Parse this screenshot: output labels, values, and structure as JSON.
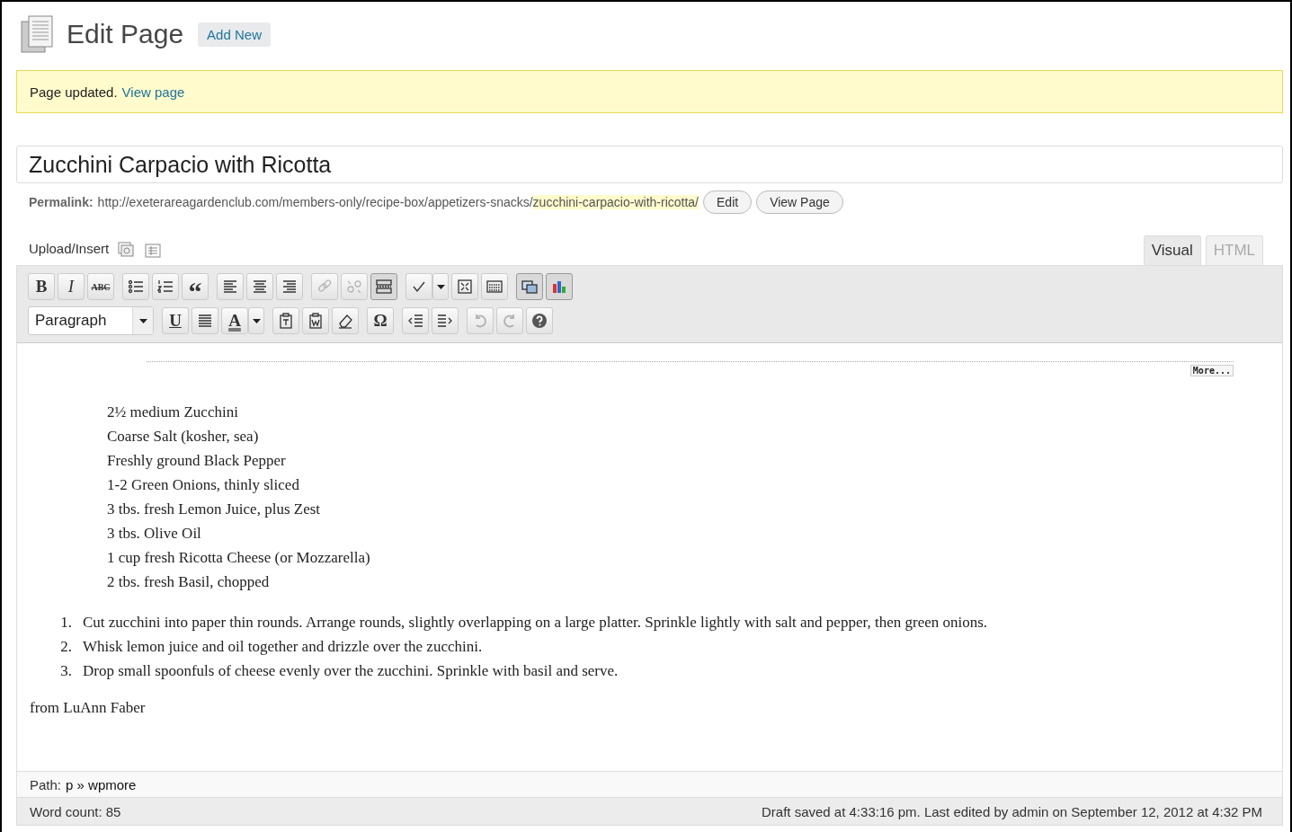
{
  "header": {
    "title": "Edit Page",
    "add_new": "Add New"
  },
  "notice": {
    "text": "Page updated.",
    "link": "View page"
  },
  "post_title": "Zucchini Carpacio with Ricotta",
  "permalink": {
    "label": "Permalink:",
    "base": "http://exeterareagardenclub.com/members-only/recipe-box/appetizers-snacks/",
    "slug": "zucchini-carpacio-with-ricotta/",
    "buttons": [
      "Edit",
      "View Page"
    ]
  },
  "upload_label": "Upload/Insert",
  "editor_tabs": [
    {
      "label": "Visual",
      "selected": true
    },
    {
      "label": "HTML",
      "selected": false
    }
  ],
  "toolbar_rows": [
    [
      [
        {
          "kind": "bold",
          "text": "B"
        },
        {
          "kind": "italic",
          "text": "I"
        },
        {
          "kind": "strike",
          "text": "ABC"
        }
      ],
      [
        {
          "kind": "bullets"
        },
        {
          "kind": "numbers"
        },
        {
          "kind": "quote",
          "text": "“"
        }
      ],
      [
        {
          "kind": "alignleft"
        },
        {
          "kind": "aligncenter"
        },
        {
          "kind": "alignright"
        }
      ],
      [
        {
          "kind": "link",
          "disabled": true
        },
        {
          "kind": "unlink",
          "disabled": true
        },
        {
          "kind": "more",
          "pressed": true
        }
      ],
      [
        {
          "kind": "spell"
        },
        {
          "kind": "dropdown"
        },
        {
          "kind": "fullscreen"
        },
        {
          "kind": "kitchen"
        }
      ],
      [
        {
          "kind": "gallery",
          "pressed": true
        },
        {
          "kind": "chart",
          "pressed": true
        }
      ]
    ],
    [
      [
        {
          "kind": "select",
          "text": "Paragraph"
        }
      ],
      [
        {
          "kind": "underline",
          "text": "U"
        },
        {
          "kind": "justify"
        },
        {
          "kind": "color",
          "text": "A"
        },
        {
          "kind": "dropdown"
        }
      ],
      [
        {
          "kind": "pastetext"
        },
        {
          "kind": "pasteword"
        },
        {
          "kind": "eraser"
        }
      ],
      [
        {
          "kind": "omega",
          "text": "Ω"
        }
      ],
      [
        {
          "kind": "outdent"
        },
        {
          "kind": "indent"
        }
      ],
      [
        {
          "kind": "undo",
          "disabled": true
        },
        {
          "kind": "redo",
          "disabled": true
        },
        {
          "kind": "help"
        }
      ]
    ]
  ],
  "more_label": "More...",
  "ingredients": [
    "2½ medium Zucchini",
    "Coarse Salt (kosher, sea)",
    "Freshly ground Black Pepper",
    "1-2 Green Onions, thinly sliced",
    "3 tbs. fresh Lemon Juice, plus Zest",
    "3 tbs. Olive Oil",
    "1 cup fresh Ricotta Cheese (or Mozzarella)",
    "2 tbs. fresh Basil, chopped"
  ],
  "steps": [
    {
      "num": "1.",
      "text": "Cut zucchini into paper thin rounds. Arrange rounds, slightly overlapping on a large platter. Sprinkle lightly with salt and pepper, then green onions."
    },
    {
      "num": "2.",
      "text": "Whisk lemon juice and oil together and drizzle over the zucchini."
    },
    {
      "num": "3.",
      "text": "Drop small spoonfuls of cheese evenly over the zucchini. Sprinkle with basil and serve."
    }
  ],
  "credit": "from LuAnn Faber",
  "path": {
    "label": "Path:",
    "value": "p » wpmore"
  },
  "word_count": "Word count: 85",
  "draft_status": "Draft saved at 4:33:16 pm. Last edited by admin on September 12, 2012 at 4:32 PM"
}
